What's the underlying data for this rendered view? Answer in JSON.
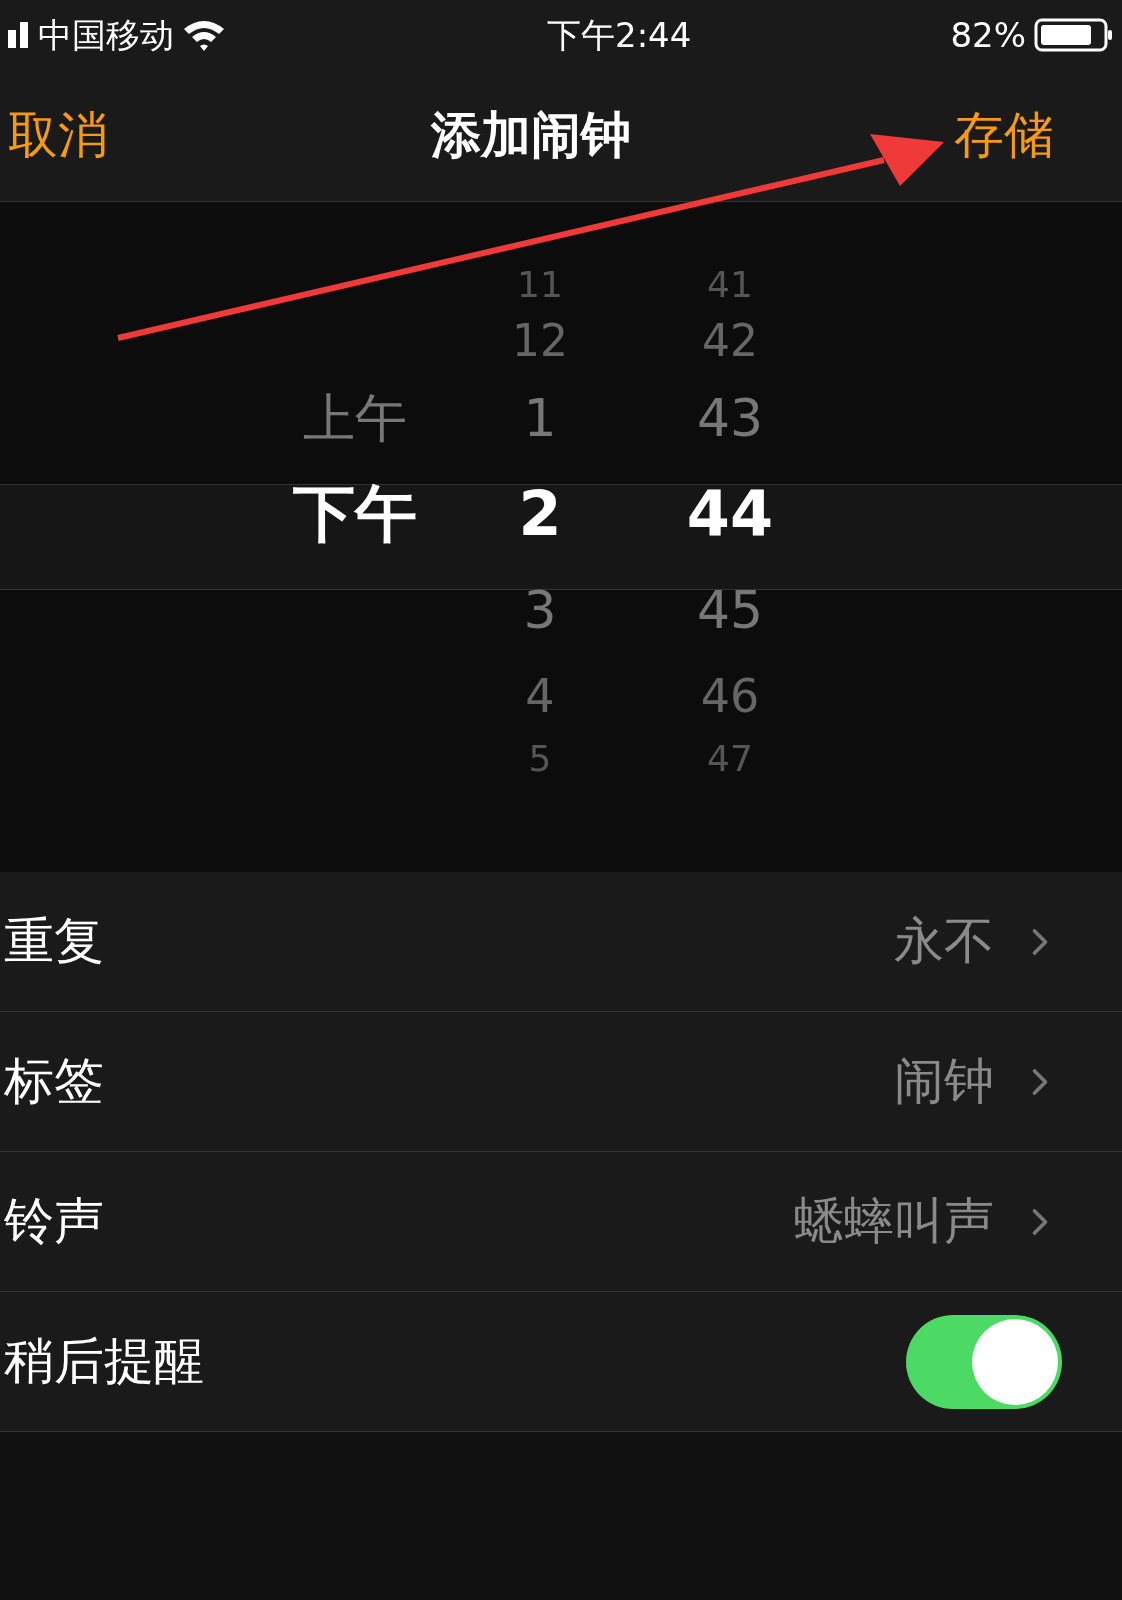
{
  "status_bar": {
    "carrier": "中国移动",
    "time": "下午2:44",
    "battery": "82%"
  },
  "nav_bar": {
    "cancel": "取消",
    "title": "添加闹钟",
    "save": "存储"
  },
  "picker": {
    "columns": [
      {
        "items": [
          {
            "label": "上午",
            "selected": false
          },
          {
            "label": "下午",
            "selected": true
          }
        ]
      },
      {
        "items": [
          {
            "label": "11",
            "selected": false
          },
          {
            "label": "12",
            "selected": false
          },
          {
            "label": "1",
            "selected": false
          },
          {
            "label": "2",
            "selected": true
          },
          {
            "label": "3",
            "selected": false
          },
          {
            "label": "4",
            "selected": false
          },
          {
            "label": "5",
            "selected": false
          }
        ]
      },
      {
        "items": [
          {
            "label": "41",
            "selected": false
          },
          {
            "label": "42",
            "selected": false
          },
          {
            "label": "43",
            "selected": false
          },
          {
            "label": "44",
            "selected": true
          },
          {
            "label": "45",
            "selected": false
          },
          {
            "label": "46",
            "selected": false
          },
          {
            "label": "47",
            "selected": false
          }
        ]
      }
    ]
  },
  "settings": [
    {
      "kind": "value",
      "label": "重复",
      "value": "永不"
    },
    {
      "kind": "value",
      "label": "标签",
      "value": "闹钟"
    },
    {
      "kind": "value",
      "label": "铃声",
      "value": "蟋蟀叫声"
    },
    {
      "kind": "switch",
      "label": "稍后提醒",
      "on": true
    }
  ]
}
